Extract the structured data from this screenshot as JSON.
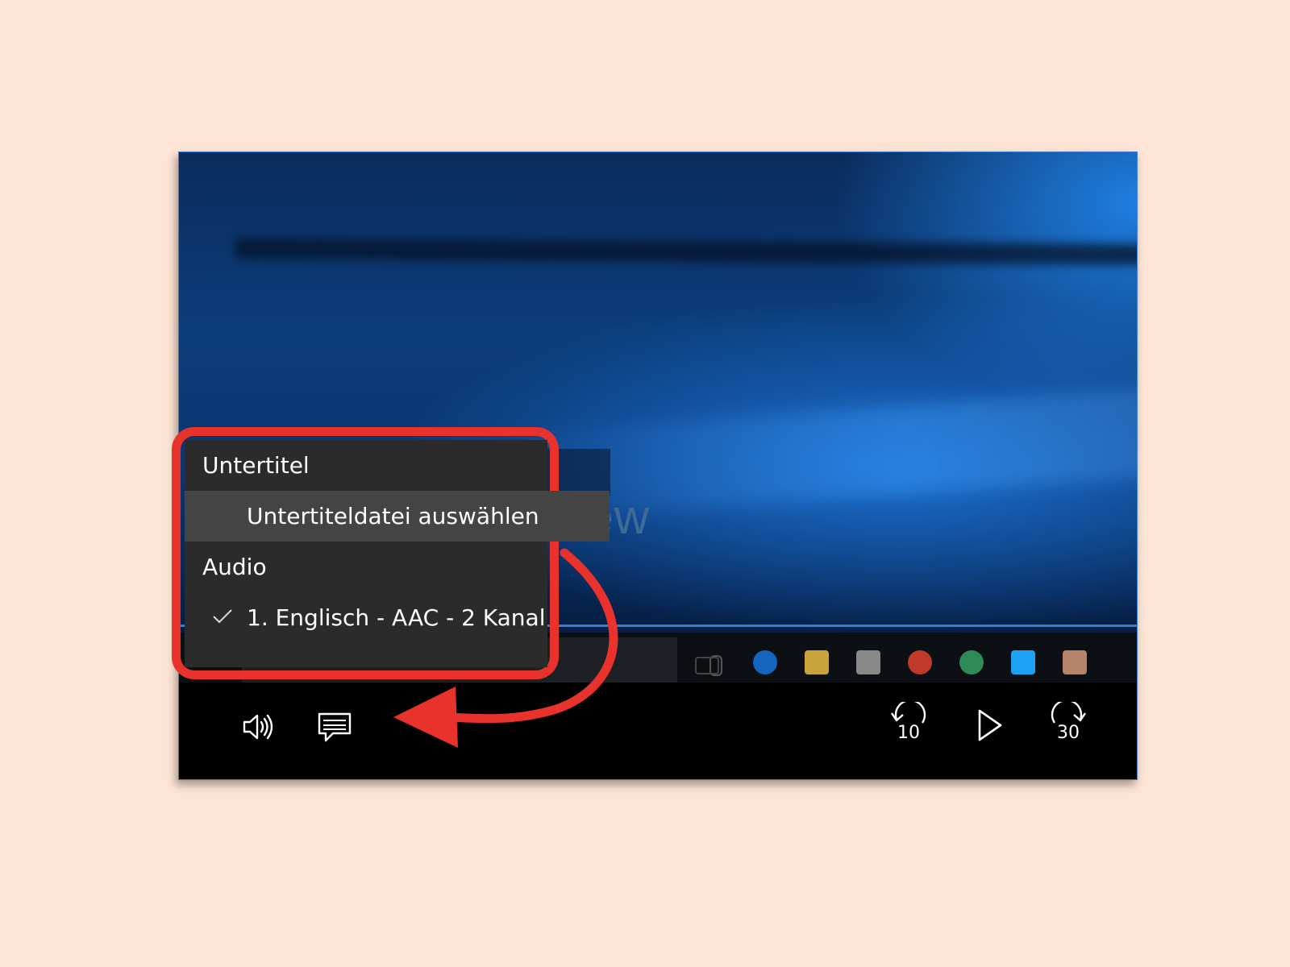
{
  "menu": {
    "subtitles_header": "Untertitel",
    "subtitles_choose_file": "Untertiteldatei auswählen",
    "audio_header": "Audio",
    "audio_track_selected": "1. Englisch - AAC - 2 Kanal"
  },
  "video": {
    "overlay_text": "view"
  },
  "controls": {
    "skip_back_seconds": "10",
    "skip_forward_seconds": "30"
  },
  "colors": {
    "page_background": "#fde4d4",
    "highlight_red": "#e8322b",
    "menu_background": "#2b2b2b",
    "menu_selected": "#444444"
  }
}
